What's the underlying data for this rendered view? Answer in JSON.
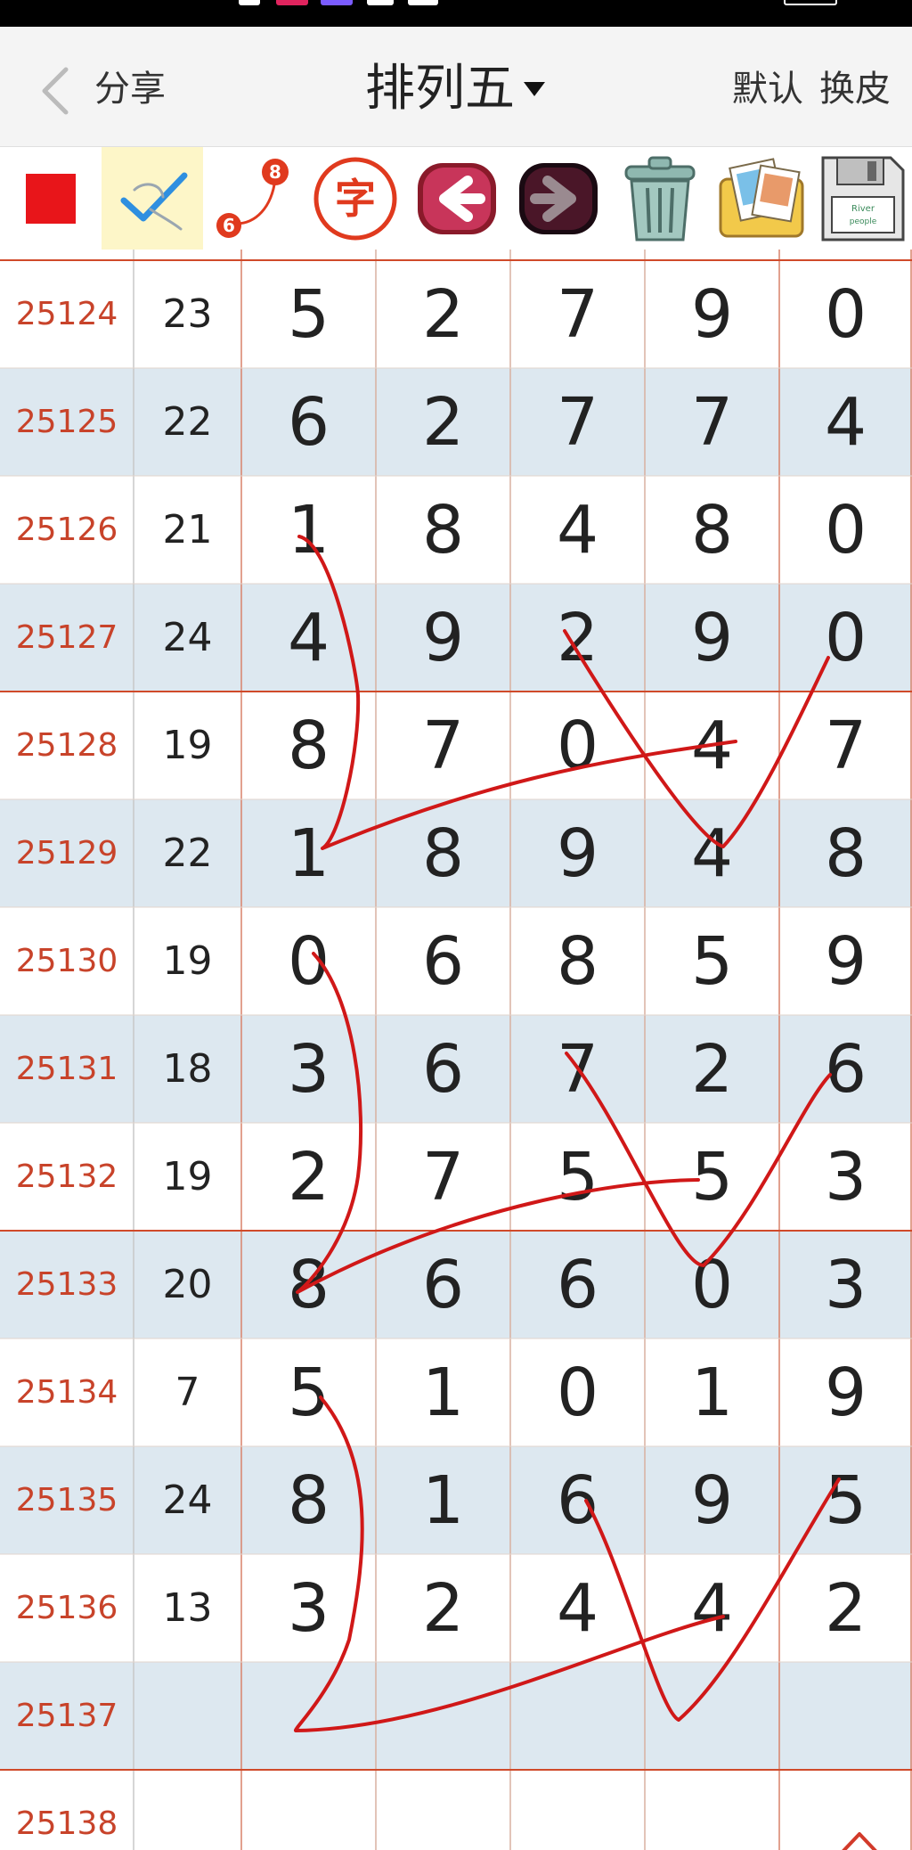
{
  "nav": {
    "share": "分享",
    "title": "排列五",
    "default": "默认",
    "skin": "换皮"
  },
  "toolbar": {
    "icons": [
      "red-square-icon",
      "checkmark-icon",
      "six-eight-icon",
      "zi-char-icon",
      "arrow-left-icon",
      "arrow-right-icon",
      "trash-icon",
      "photos-icon",
      "floppy-disk-icon"
    ],
    "badge_a": "8",
    "badge_b": "6",
    "zi": "字",
    "floppy_text": "River",
    "floppy_sub": "people"
  },
  "rows": [
    {
      "issue": "25124",
      "sum": "23",
      "digits": [
        "5",
        "2",
        "7",
        "9",
        "0"
      ]
    },
    {
      "issue": "25125",
      "sum": "22",
      "digits": [
        "6",
        "2",
        "7",
        "7",
        "4"
      ]
    },
    {
      "issue": "25126",
      "sum": "21",
      "digits": [
        "1",
        "8",
        "4",
        "8",
        "0"
      ]
    },
    {
      "issue": "25127",
      "sum": "24",
      "digits": [
        "4",
        "9",
        "2",
        "9",
        "0"
      ]
    },
    {
      "issue": "25128",
      "sum": "19",
      "digits": [
        "8",
        "7",
        "0",
        "4",
        "7"
      ]
    },
    {
      "issue": "25129",
      "sum": "22",
      "digits": [
        "1",
        "8",
        "9",
        "4",
        "8"
      ]
    },
    {
      "issue": "25130",
      "sum": "19",
      "digits": [
        "0",
        "6",
        "8",
        "5",
        "9"
      ]
    },
    {
      "issue": "25131",
      "sum": "18",
      "digits": [
        "3",
        "6",
        "7",
        "2",
        "6"
      ]
    },
    {
      "issue": "25132",
      "sum": "19",
      "digits": [
        "2",
        "7",
        "5",
        "5",
        "3"
      ]
    },
    {
      "issue": "25133",
      "sum": "20",
      "digits": [
        "8",
        "6",
        "6",
        "0",
        "3"
      ]
    },
    {
      "issue": "25134",
      "sum": "7",
      "digits": [
        "5",
        "1",
        "0",
        "1",
        "9"
      ]
    },
    {
      "issue": "25135",
      "sum": "24",
      "digits": [
        "8",
        "1",
        "6",
        "9",
        "5"
      ]
    },
    {
      "issue": "25136",
      "sum": "13",
      "digits": [
        "3",
        "2",
        "4",
        "4",
        "2"
      ]
    },
    {
      "issue": "25137",
      "sum": "",
      "digits": [
        "",
        "",
        "",
        "",
        ""
      ]
    },
    {
      "issue": "25138",
      "sum": "",
      "digits": [
        "",
        "",
        "",
        "",
        ""
      ]
    }
  ],
  "colors": {
    "issue_text": "#c8432a",
    "row_alt_bg": "#dde8f0",
    "group_line": "#d04a2a",
    "stroke": "#d01818"
  }
}
